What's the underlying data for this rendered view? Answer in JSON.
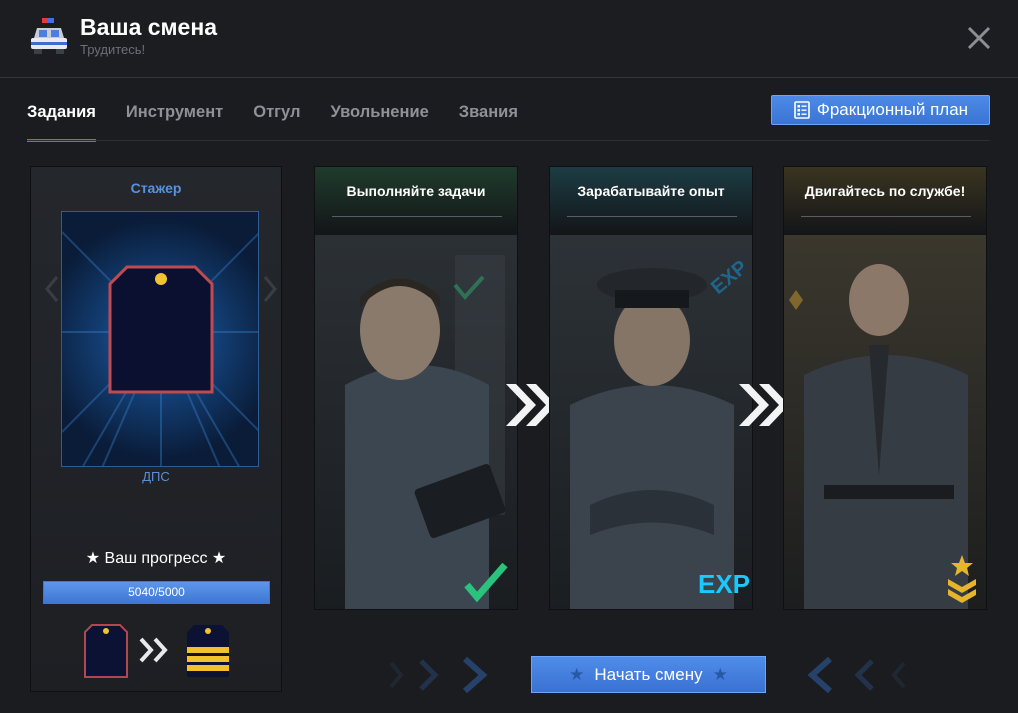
{
  "header": {
    "title": "Ваша смена",
    "subtitle": "Трудитесь!"
  },
  "tabs": [
    {
      "label": "Задания",
      "active": true
    },
    {
      "label": "Инструмент",
      "active": false
    },
    {
      "label": "Отгул",
      "active": false
    },
    {
      "label": "Увольнение",
      "active": false
    },
    {
      "label": "Звания",
      "active": false
    }
  ],
  "plan_button": {
    "label": "Фракционный план",
    "icon": "checklist-icon"
  },
  "rank": {
    "title": "Стажер",
    "department": "ДПС",
    "progress_label": "★ Ваш прогресс ★",
    "progress_current": 5040,
    "progress_max": 5000,
    "progress_text": "5040/5000"
  },
  "cards": [
    {
      "caption": "Выполняйте задачи",
      "badge": "checkmark-icon"
    },
    {
      "caption": "Зарабатывайте опыт",
      "badge": "EXP"
    },
    {
      "caption": "Двигайтесь по службе!",
      "badge": "rank-chevron-icon"
    }
  ],
  "start_button": {
    "label": "Начать смену"
  },
  "colors": {
    "accent": "#3f7fe0",
    "green": "#29c37e",
    "cyan": "#19c9ff",
    "gold": "#e7b52c"
  }
}
